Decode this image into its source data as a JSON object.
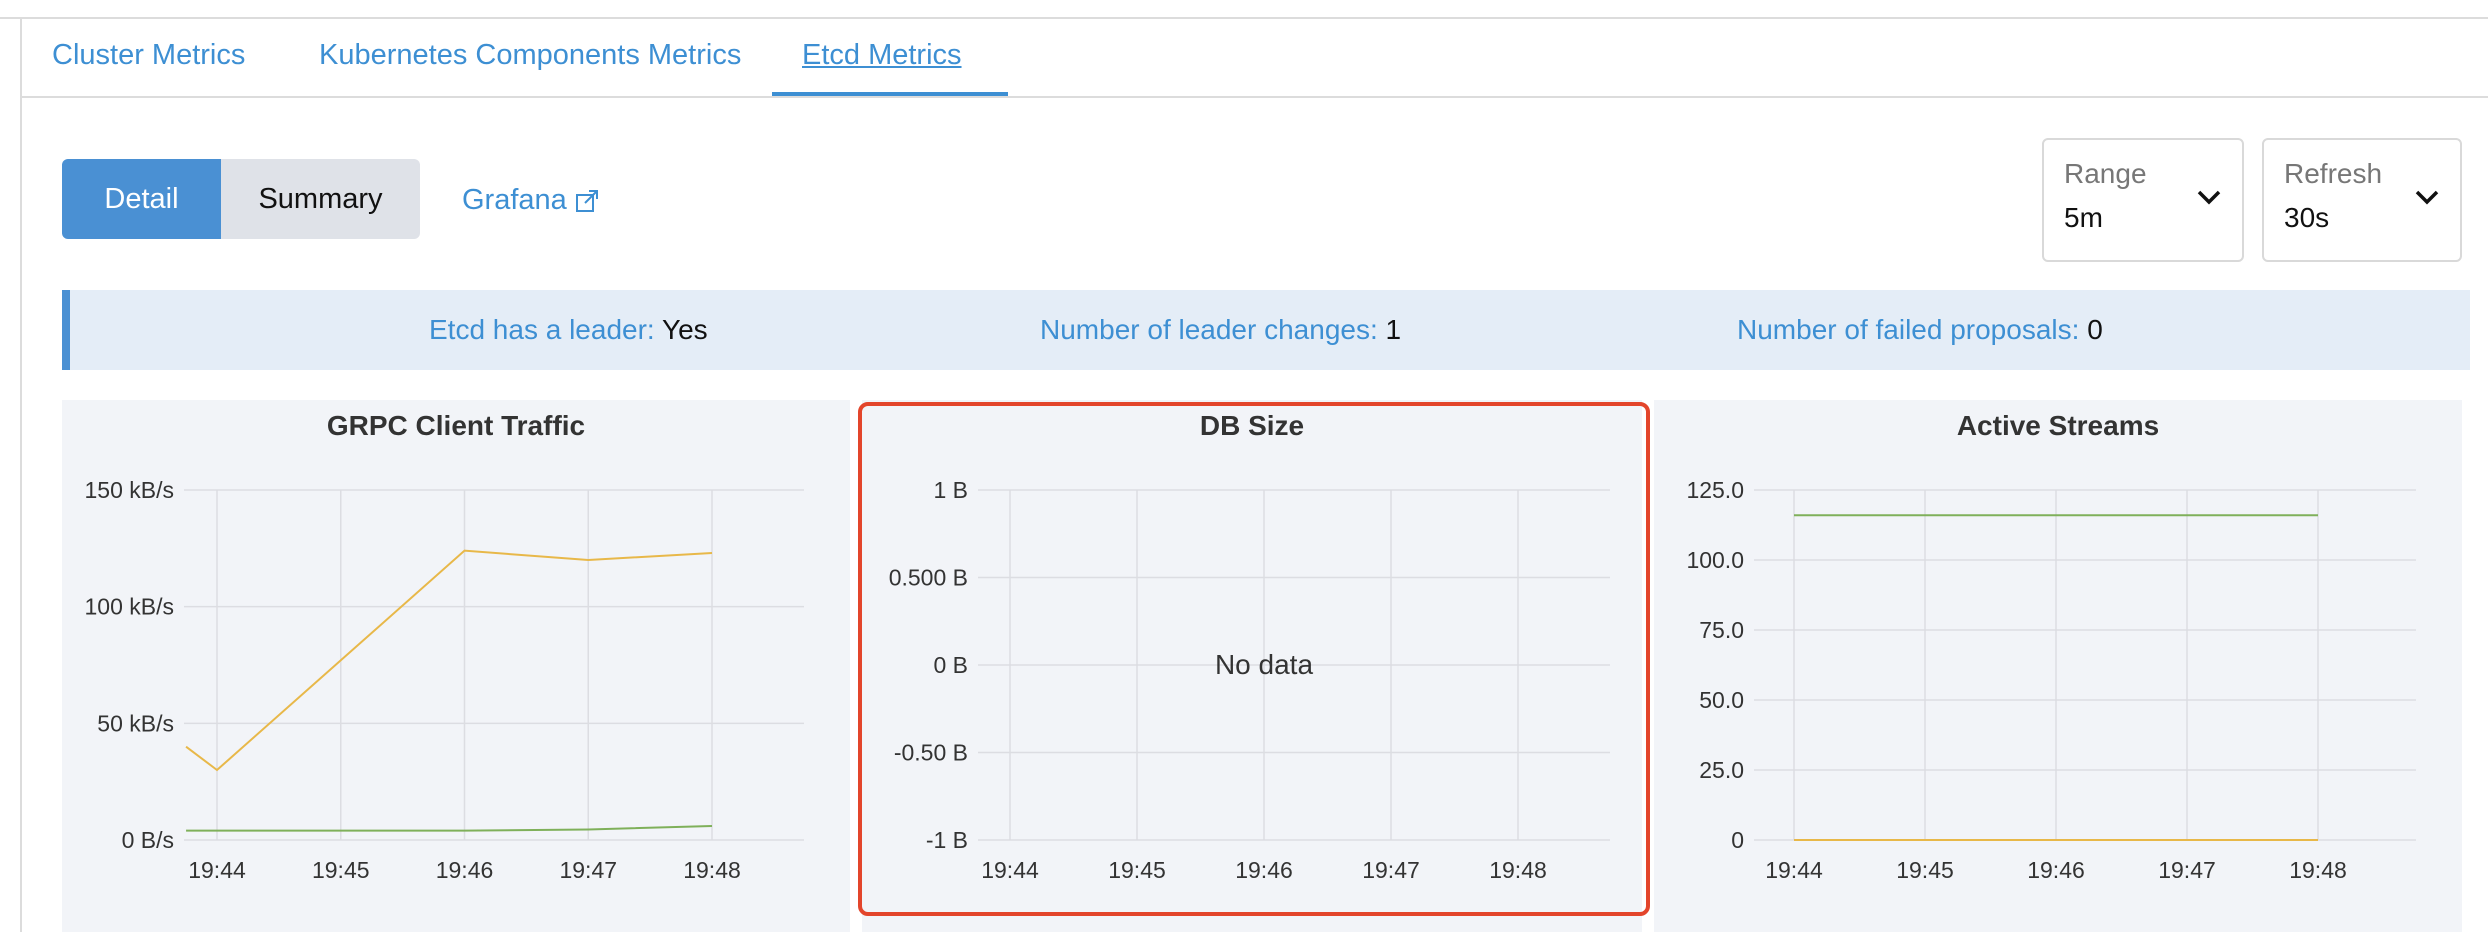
{
  "tabs": [
    "Cluster Metrics",
    "Kubernetes Components Metrics",
    "Etcd Metrics"
  ],
  "view_toggle": {
    "detail": "Detail",
    "summary": "Summary"
  },
  "grafana_link": "Grafana",
  "range": {
    "label": "Range",
    "value": "5m"
  },
  "refresh": {
    "label": "Refresh",
    "value": "30s"
  },
  "banner": {
    "leader_label": "Etcd has a leader:",
    "leader_value": "Yes",
    "changes_label": "Number of leader changes:",
    "changes_value": "1",
    "failed_label": "Number of failed proposals:",
    "failed_value": "0"
  },
  "colors": {
    "accent": "#4a90d3",
    "series_orange": "#e8b849",
    "series_green": "#7fb05a",
    "highlight": "#e3452b"
  },
  "chart_data": [
    {
      "type": "line",
      "title": "GRPC Client Traffic",
      "x": [
        "19:44",
        "19:45",
        "19:46",
        "19:47",
        "19:48"
      ],
      "ytick_labels": [
        "0 B/s",
        "50 kB/s",
        "100 kB/s",
        "150 kB/s"
      ],
      "ylim": [
        0,
        150
      ],
      "series": [
        {
          "color": "#e8b849",
          "points": [
            [
              -0.25,
              40
            ],
            [
              0,
              30
            ],
            [
              2,
              124
            ],
            [
              3,
              120
            ],
            [
              4,
              123
            ]
          ]
        },
        {
          "color": "#7fb05a",
          "points": [
            [
              -0.25,
              4
            ],
            [
              0,
              4
            ],
            [
              2,
              4
            ],
            [
              3,
              4.5
            ],
            [
              4,
              6
            ]
          ]
        }
      ]
    },
    {
      "type": "line",
      "title": "DB Size",
      "x": [
        "19:44",
        "19:45",
        "19:46",
        "19:47",
        "19:48"
      ],
      "ytick_labels": [
        "-1 B",
        "-0.50 B",
        "0 B",
        "0.500 B",
        "1 B"
      ],
      "ylim": [
        -1,
        1
      ],
      "no_data": "No data",
      "series": []
    },
    {
      "type": "line",
      "title": "Active Streams",
      "x": [
        "19:44",
        "19:45",
        "19:46",
        "19:47",
        "19:48"
      ],
      "ytick_labels": [
        "0",
        "25.0",
        "50.0",
        "75.0",
        "100.0",
        "125.0"
      ],
      "ylim": [
        0,
        125
      ],
      "series": [
        {
          "color": "#7fb05a",
          "points": [
            [
              0,
              116
            ],
            [
              4,
              116
            ]
          ]
        },
        {
          "color": "#e8b849",
          "points": [
            [
              0,
              0
            ],
            [
              4,
              0
            ]
          ]
        }
      ]
    }
  ]
}
